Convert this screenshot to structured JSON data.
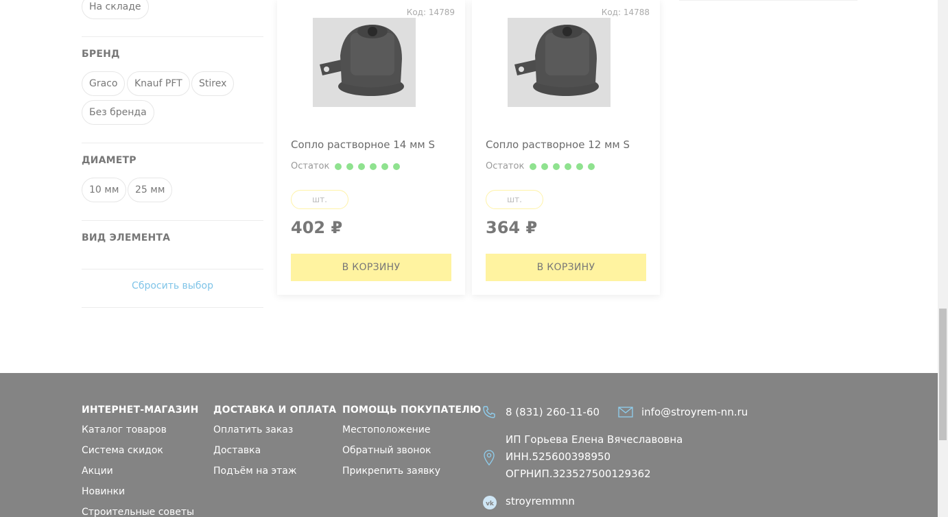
{
  "filters": {
    "stock_chip": "На складе",
    "brand": {
      "title": "БРЕНД",
      "options": [
        "Graco",
        "Knauf PFT",
        "Stirex",
        "Без бренда"
      ]
    },
    "diameter": {
      "title": "ДИАМЕТР",
      "options": [
        "10 мм",
        "25 мм"
      ]
    },
    "element_type": {
      "title": "ВИД ЭЛЕМЕНТА"
    },
    "reset_label": "Сбросить выбор"
  },
  "products": [
    {
      "code": "Код: 14789",
      "name": "Сопло растворное 14 мм S",
      "stock_label": "Остаток",
      "stock_level": 6,
      "unit": "шт.",
      "price": "402 ₽",
      "cart_label": "В КОРЗИНУ"
    },
    {
      "code": "Код: 14788",
      "name": "Сопло растворное 12 мм S",
      "stock_label": "Остаток",
      "stock_level": 6,
      "unit": "шт.",
      "price": "364 ₽",
      "cart_label": "В КОРЗИНУ"
    }
  ],
  "footer": {
    "columns": [
      {
        "title": "ИНТЕРНЕТ-МАГАЗИН",
        "links": [
          "Каталог товаров",
          "Система скидок",
          "Акции",
          "Новинки",
          "Строительные советы"
        ]
      },
      {
        "title": "ДОСТАВКА И ОПЛАТА",
        "links": [
          "Оплатить заказ",
          "Доставка",
          "Подъём на этаж"
        ]
      },
      {
        "title": "ПОМОЩЬ ПОКУПАТЕЛЮ",
        "links": [
          "Местоположение",
          "Обратный звонок",
          "Прикрепить заявку"
        ]
      }
    ],
    "phone": "8 (831) 260-11-60",
    "email": "info@stroyrem-nn.ru",
    "company": {
      "name": "ИП Горьева Елена Вячеславовна",
      "inn": "ИНН.525600398950",
      "ogrn": "ОГРНИП.323527500129362"
    },
    "vk": "stroyremmnn",
    "icons": {
      "phone": "phone-icon",
      "email": "mail-icon",
      "location": "location-pin-icon",
      "vk": "vk-icon"
    }
  },
  "colors": {
    "footer_bg": "#848484",
    "cart_button": "#fff3a0",
    "stock_dot": "#8fe28f",
    "reset_link": "#7fc4e8"
  }
}
